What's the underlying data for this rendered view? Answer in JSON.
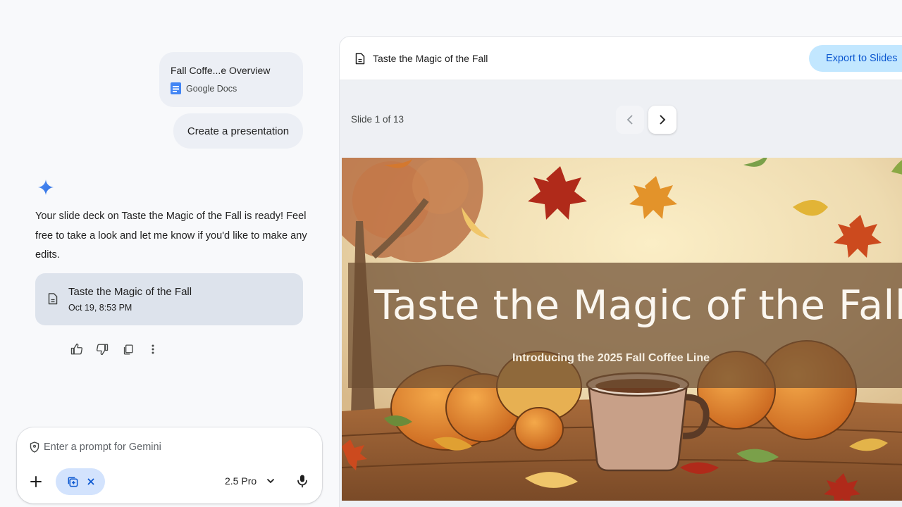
{
  "chat": {
    "attachment": {
      "title": "Fall Coffe...e Overview",
      "source": "Google Docs",
      "icon": "google-docs-icon"
    },
    "user_message": "Create a presentation",
    "reply": "Your slide deck on Taste the Magic of the Fall is ready! Feel free to take a look and let me know if you'd like to make any edits.",
    "file_card": {
      "title": "Taste the Magic of the Fall",
      "date": "Oct 19, 8:53 PM"
    },
    "actions": [
      "thumbs-up-icon",
      "thumbs-down-icon",
      "copy-icon",
      "more-vert-icon"
    ]
  },
  "prompt": {
    "placeholder": "Enter a prompt for Gemini",
    "model": "2.5 Pro"
  },
  "preview": {
    "doc_title": "Taste the Magic of the Fall",
    "export_label": "Export to Slides",
    "slide_counter": "Slide 1 of 13",
    "slide": {
      "title": "Taste the Magic of the Fall",
      "subtitle": "Introducing the 2025 Fall Coffee Line"
    }
  },
  "colors": {
    "accent_blue": "#0b57d0",
    "export_bg": "#c2e7ff",
    "chip_bg": "#eceff5",
    "card_bg": "#dde3ec",
    "spark": "#4285f4"
  }
}
